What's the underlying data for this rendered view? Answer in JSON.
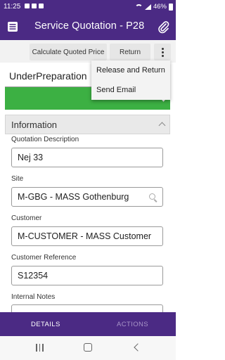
{
  "status_bar": {
    "time": "11:25",
    "battery": "46%"
  },
  "app_bar": {
    "title": "Service Quotation - P28"
  },
  "toolbar": {
    "calculate_label": "Calculate Quoted Price",
    "return_label": "Return"
  },
  "status": {
    "tab_label": "UnderPreparation",
    "indicator_color": "#3cb043"
  },
  "dropdown": {
    "items": [
      {
        "label": "Release and Return"
      },
      {
        "label": "Send Email"
      }
    ]
  },
  "information": {
    "header": "Information",
    "fields": {
      "quotation_description": {
        "label": "Quotation Description",
        "value": "Nej 33"
      },
      "site": {
        "label": "Site",
        "value": "M-GBG - MASS Gothenburg"
      },
      "customer": {
        "label": "Customer",
        "value": "M-CUSTOMER - MASS Customer"
      },
      "customer_reference": {
        "label": "Customer Reference",
        "value": "S12354"
      },
      "internal_notes": {
        "label": "Internal Notes",
        "value": ""
      }
    }
  },
  "bottom_nav": {
    "tabs": [
      {
        "label": "DETAILS",
        "active": true
      },
      {
        "label": "ACTIONS",
        "active": false
      }
    ]
  },
  "colors": {
    "brand": "#4b2a84",
    "status_green": "#3cb043"
  }
}
